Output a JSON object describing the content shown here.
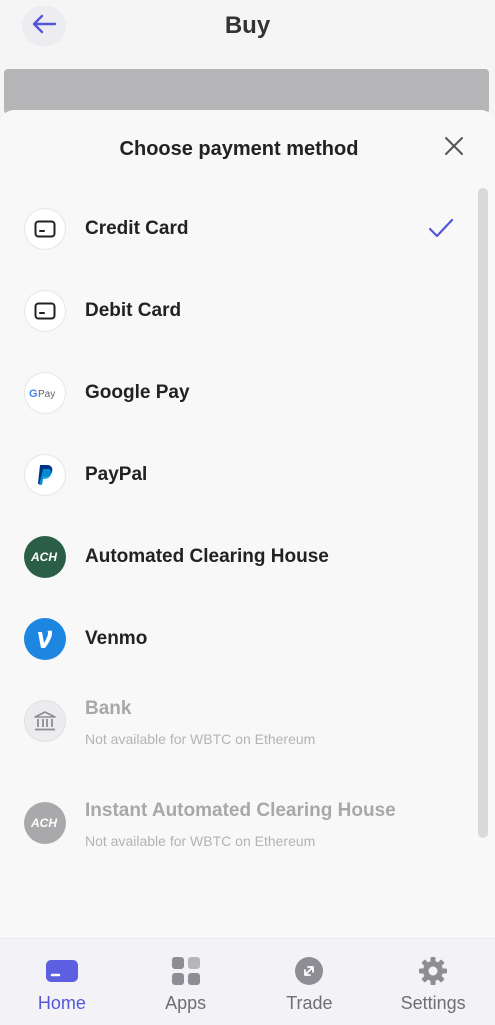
{
  "header": {
    "title": "Buy",
    "back_icon": "arrow-left-icon"
  },
  "sheet": {
    "title": "Choose payment method",
    "close_icon": "close-icon",
    "selected_method": "Credit Card",
    "methods": [
      {
        "label": "Credit Card",
        "icon": "credit-card-icon",
        "enabled": true,
        "selected": true
      },
      {
        "label": "Debit Card",
        "icon": "debit-card-icon",
        "enabled": true
      },
      {
        "label": "Google Pay",
        "icon": "google-pay-icon",
        "icon_text": "G Pay",
        "enabled": true
      },
      {
        "label": "PayPal",
        "icon": "paypal-icon",
        "enabled": true
      },
      {
        "label": "Automated Clearing House",
        "icon": "ach-icon",
        "icon_text": "ACH",
        "enabled": true
      },
      {
        "label": "Venmo",
        "icon": "venmo-icon",
        "enabled": true
      },
      {
        "label": "Bank",
        "icon": "bank-icon",
        "enabled": false,
        "sublabel": "Not available for WBTC on Ethereum"
      },
      {
        "label": "Instant Automated Clearing House",
        "icon": "ach-icon",
        "icon_text": "ACH",
        "enabled": false,
        "sublabel": "Not available for WBTC on Ethereum"
      }
    ]
  },
  "nav": {
    "items": [
      {
        "label": "Home",
        "icon": "home-icon",
        "active": true
      },
      {
        "label": "Apps",
        "icon": "apps-grid-icon"
      },
      {
        "label": "Trade",
        "icon": "trade-icon"
      },
      {
        "label": "Settings",
        "icon": "gear-icon"
      }
    ]
  },
  "colors": {
    "accent": "#5358d6",
    "ach_green": "#2b5e46",
    "venmo_blue": "#1d86e0",
    "disabled_text": "#a8a8aa"
  }
}
